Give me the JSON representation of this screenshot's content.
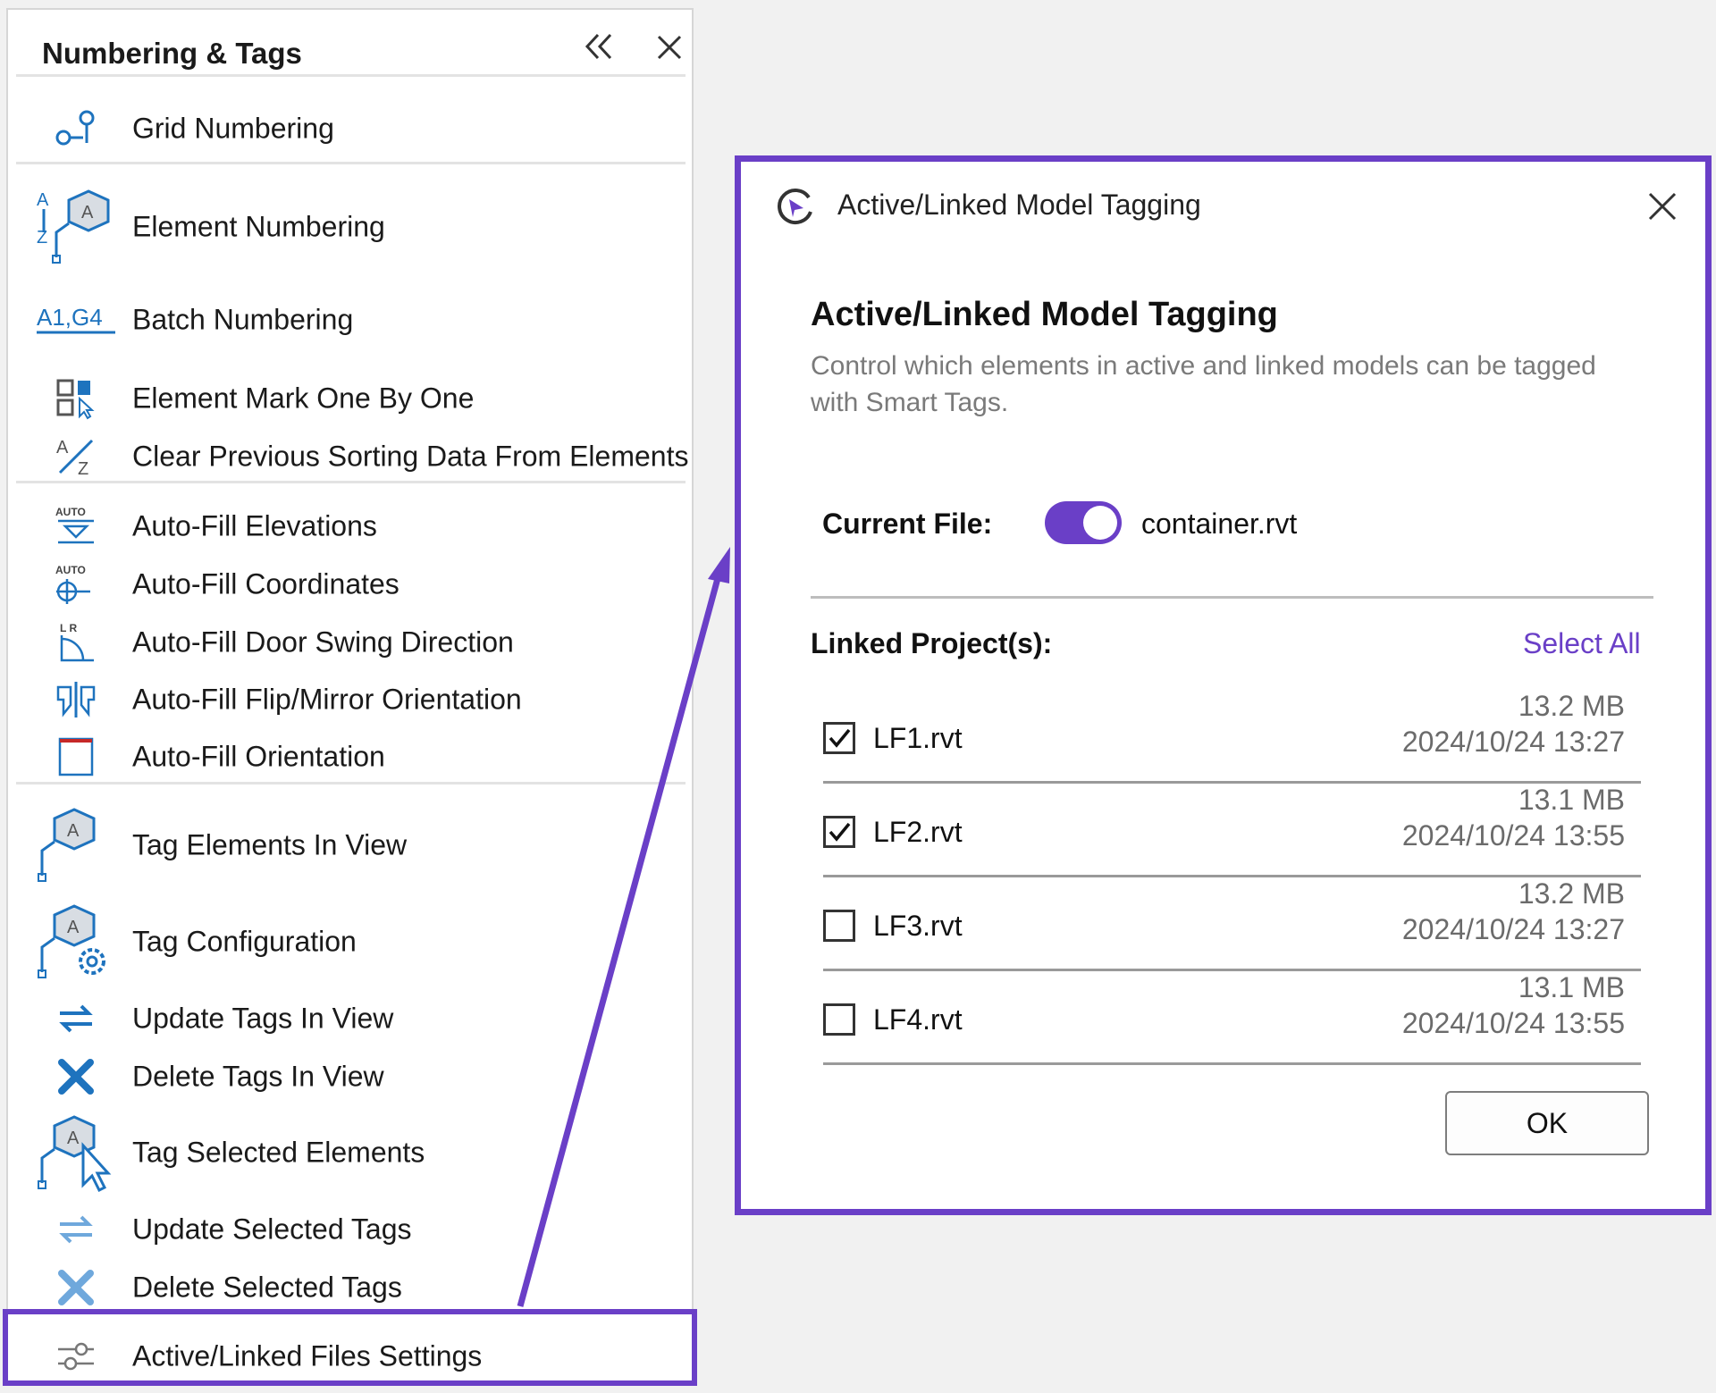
{
  "panel": {
    "title": "Numbering & Tags",
    "collapse_icon": "double-chevron-left-icon",
    "close_icon": "close-icon",
    "items": [
      {
        "label": "Grid Numbering",
        "icon": "grid-numbering-icon"
      },
      {
        "label": "Element Numbering",
        "icon": "element-numbering-icon"
      },
      {
        "label": "Batch Numbering",
        "icon": "batch-numbering-icon",
        "icon_text": "A1,G4"
      },
      {
        "label": "Element Mark One By One",
        "icon": "element-mark-icon"
      },
      {
        "label": "Clear Previous Sorting Data From Elements",
        "icon": "clear-sorting-icon"
      },
      {
        "label": "Auto-Fill Elevations",
        "icon": "autofill-elevations-icon"
      },
      {
        "label": "Auto-Fill Coordinates",
        "icon": "autofill-coordinates-icon"
      },
      {
        "label": "Auto-Fill Door Swing Direction",
        "icon": "autofill-door-swing-icon"
      },
      {
        "label": "Auto-Fill Flip/Mirror Orientation",
        "icon": "autofill-flip-icon"
      },
      {
        "label": "Auto-Fill Orientation",
        "icon": "autofill-orientation-icon"
      },
      {
        "label": "Tag Elements In View",
        "icon": "tag-elements-icon"
      },
      {
        "label": "Tag Configuration",
        "icon": "tag-configuration-icon"
      },
      {
        "label": "Update Tags In View",
        "icon": "update-tags-icon"
      },
      {
        "label": "Delete Tags In View",
        "icon": "delete-tags-icon"
      },
      {
        "label": "Tag Selected Elements",
        "icon": "tag-selected-icon"
      },
      {
        "label": "Update Selected Tags",
        "icon": "update-selected-icon"
      },
      {
        "label": "Delete Selected Tags",
        "icon": "delete-selected-icon"
      },
      {
        "label": "Active/Linked Files Settings",
        "icon": "sliders-icon"
      }
    ],
    "icon_small_text": {
      "auto": "AUTO",
      "lr": "L R",
      "a": "A",
      "z": "Z"
    }
  },
  "dialog": {
    "window_title": "Active/Linked Model Tagging",
    "heading": "Active/Linked Model Tagging",
    "description": "Control which elements in active and linked models can be tagged with Smart Tags.",
    "current_file_label": "Current File:",
    "current_file_toggle_on": true,
    "current_file_name": "container.rvt",
    "linked_label": "Linked Project(s):",
    "select_all_label": "Select All",
    "linked_files": [
      {
        "name": "LF1.rvt",
        "size": "13.2 MB",
        "date": "2024/10/24 13:27",
        "checked": true
      },
      {
        "name": "LF2.rvt",
        "size": "13.1 MB",
        "date": "2024/10/24 13:55",
        "checked": true
      },
      {
        "name": "LF3.rvt",
        "size": "13.2 MB",
        "date": "2024/10/24 13:27",
        "checked": false
      },
      {
        "name": "LF4.rvt",
        "size": "13.1 MB",
        "date": "2024/10/24 13:55",
        "checked": false
      }
    ],
    "ok_label": "OK"
  },
  "colors": {
    "accent": "#6a3fc7",
    "icon_blue": "#1e73be",
    "icon_red": "#c62828"
  }
}
